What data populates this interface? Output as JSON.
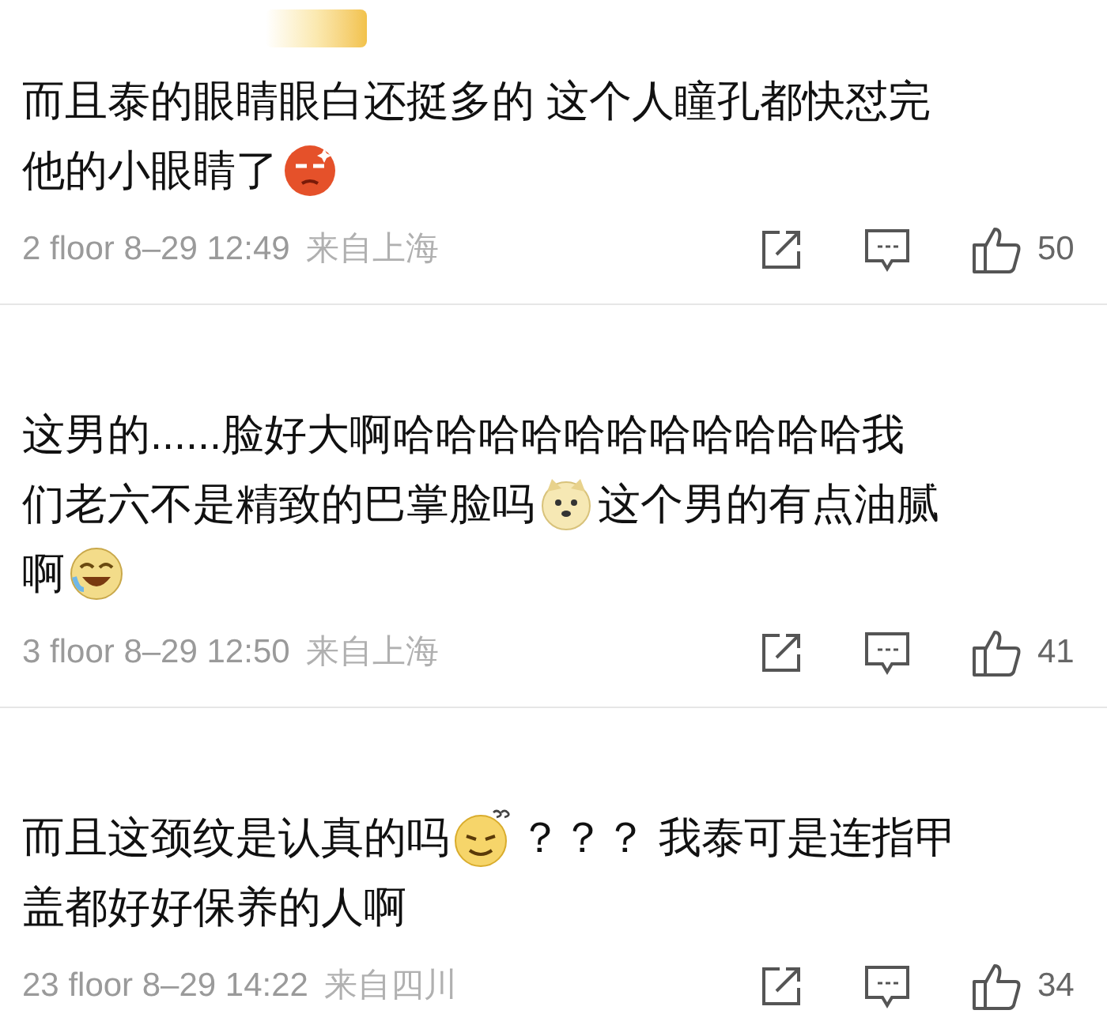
{
  "comments": [
    {
      "lines": [
        [
          {
            "kind": "text",
            "text": "而且泰的眼睛眼白还挺多的 这个人瞳孔都快怼完"
          }
        ],
        [
          {
            "kind": "text",
            "text": "他的小眼睛了"
          },
          {
            "kind": "angry"
          }
        ]
      ],
      "floor": "2 floor 8–29 12:49",
      "location": "来自上海",
      "likes": "50"
    },
    {
      "lines": [
        [
          {
            "kind": "text",
            "text": "这男的......脸好大啊哈哈哈哈哈哈哈哈哈哈哈我"
          }
        ],
        [
          {
            "kind": "text",
            "text": "们老六不是精致的巴掌脸吗"
          },
          {
            "kind": "doge"
          },
          {
            "kind": "text",
            "text": "这个男的有点油腻"
          }
        ],
        [
          {
            "kind": "text",
            "text": "啊"
          },
          {
            "kind": "laugh"
          }
        ]
      ],
      "floor": "3 floor 8–29 12:50",
      "location": "来自上海",
      "likes": "41"
    },
    {
      "lines": [
        [
          {
            "kind": "text",
            "text": "而且这颈纹是认真的吗"
          },
          {
            "kind": "puzzled"
          },
          {
            "kind": "text",
            "text": "？？？ 我泰可是连指甲"
          }
        ],
        [
          {
            "kind": "text",
            "text": "盖都好好保养的人啊"
          }
        ]
      ],
      "floor": "23 floor 8–29 14:22",
      "location": "来自四川",
      "likes": "34"
    }
  ]
}
